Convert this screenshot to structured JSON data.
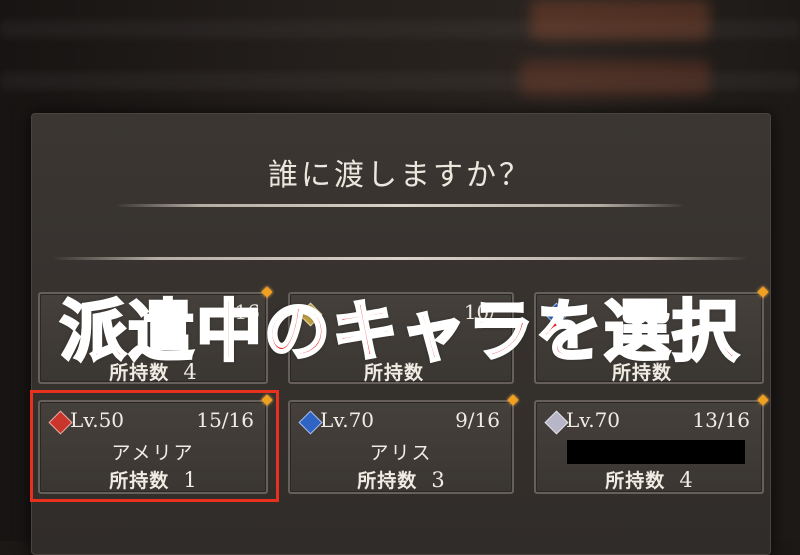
{
  "dialog": {
    "title": "誰に渡しますか？"
  },
  "overlay_caption": "派遣中のキャラを選択",
  "colors": {
    "accent_orange": "#f0a020",
    "highlight_red": "#e8301e",
    "caption_red": "#e81010"
  },
  "top_row": [
    {
      "count": "16",
      "owned_label": "所持数",
      "owned_value": "4"
    },
    {
      "count": "10/",
      "owned_label": "所持数",
      "owned_value": ""
    },
    {
      "count": "",
      "owned_label": "所持数",
      "owned_value": ""
    }
  ],
  "characters": [
    {
      "element_icon": "fire-gem-icon",
      "element_color": "#c9352b",
      "level": "Lv.50",
      "count": "15/16",
      "name": "アメリア",
      "owned_label": "所持数",
      "owned_value": "1",
      "selected": true
    },
    {
      "element_icon": "water-gem-icon",
      "element_color": "#2f63c4",
      "level": "Lv.70",
      "count": "9/16",
      "name": "アリス",
      "owned_label": "所持数",
      "owned_value": "3",
      "selected": false
    },
    {
      "element_icon": "light-gem-icon",
      "element_color": "#b6b6c8",
      "level": "Lv.70",
      "count": "13/16",
      "name": "",
      "name_redacted": true,
      "owned_label": "所持数",
      "owned_value": "4",
      "selected": false
    }
  ]
}
